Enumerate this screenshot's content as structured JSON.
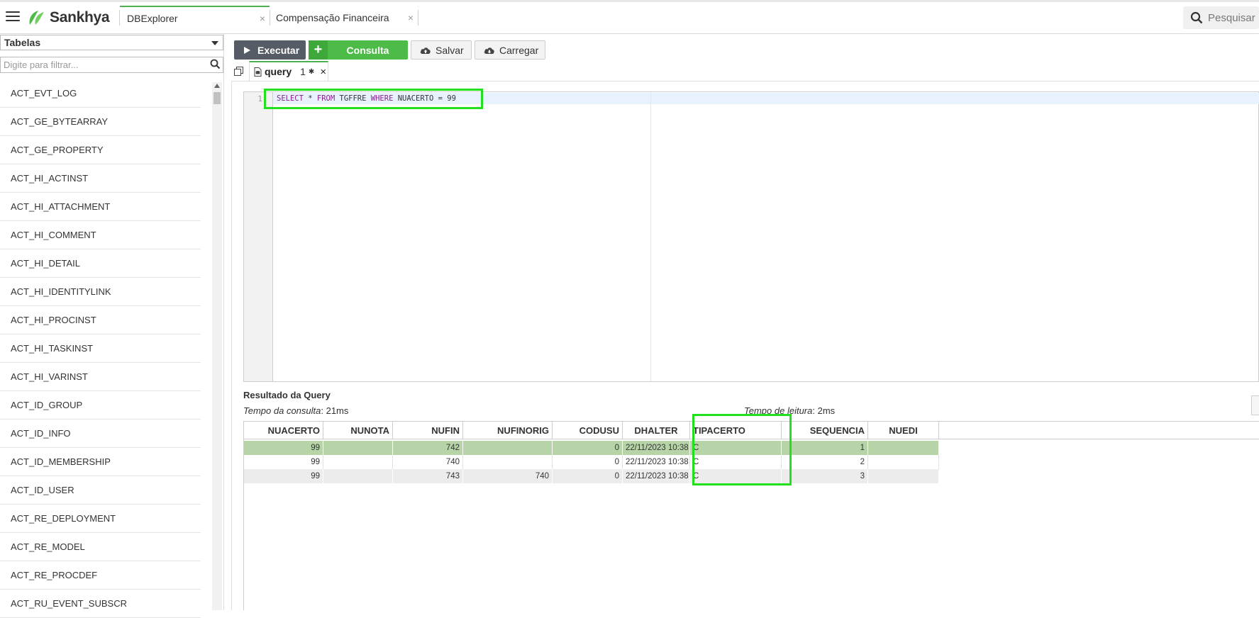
{
  "app": {
    "brand": "Sankhya",
    "tabs": [
      {
        "label": "DBExplorer",
        "close": "×"
      },
      {
        "label": "Compensação Financeira",
        "close": "×"
      }
    ],
    "search_label": "Pesquisar"
  },
  "sidebar": {
    "select_value": "Tabelas",
    "filter_placeholder": "Digite para filtrar...",
    "tables": [
      "ACT_EVT_LOG",
      "ACT_GE_BYTEARRAY",
      "ACT_GE_PROPERTY",
      "ACT_HI_ACTINST",
      "ACT_HI_ATTACHMENT",
      "ACT_HI_COMMENT",
      "ACT_HI_DETAIL",
      "ACT_HI_IDENTITYLINK",
      "ACT_HI_PROCINST",
      "ACT_HI_TASKINST",
      "ACT_HI_VARINST",
      "ACT_ID_GROUP",
      "ACT_ID_INFO",
      "ACT_ID_MEMBERSHIP",
      "ACT_ID_USER",
      "ACT_RE_DEPLOYMENT",
      "ACT_RE_MODEL",
      "ACT_RE_PROCDEF",
      "ACT_RU_EVENT_SUBSCR"
    ]
  },
  "toolbar": {
    "execute_label": "Executar",
    "new_query_label": "Consulta",
    "save_label": "Salvar",
    "load_label": "Carregar"
  },
  "editor": {
    "tab_name": "query",
    "tab_number": "1",
    "modified_marker": "✱",
    "close": "×",
    "line_number": "1",
    "sql": {
      "select": "SELECT",
      "p1": " * ",
      "from": "FROM",
      "p2": " TGFFRE ",
      "where": "WHERE",
      "p3": " NUACERTO = 99"
    }
  },
  "results": {
    "title": "Resultado da Query",
    "query_time_label": "Tempo da consulta",
    "query_time_value": ": 21ms",
    "read_time_label": "Tempo de leitura",
    "read_time_value": ": 2ms",
    "columns": [
      "NUACERTO",
      "NUNOTA",
      "NUFIN",
      "NUFINORIG",
      "CODUSU",
      "DHALTER",
      "TIPACERTO",
      "SEQUENCIA",
      "NUEDI"
    ],
    "rows": [
      [
        "99",
        "",
        "742",
        "",
        "0",
        "22/11/2023 10:38",
        "C",
        "1",
        ""
      ],
      [
        "99",
        "",
        "740",
        "",
        "0",
        "22/11/2023 10:38",
        "C",
        "2",
        ""
      ],
      [
        "99",
        "",
        "743",
        "740",
        "0",
        "22/11/2023 10:38",
        "C",
        "3",
        ""
      ]
    ]
  },
  "colors": {
    "accent_green": "#4cbb47",
    "highlight_box": "#22e01e",
    "selected_row": "#b7d4a9",
    "execute_button": "#555c65"
  }
}
